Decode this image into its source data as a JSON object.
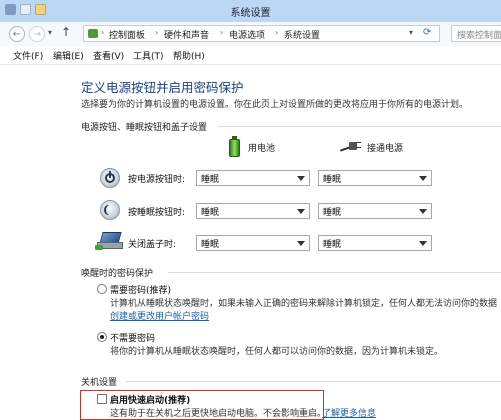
{
  "window": {
    "title": "系统设置"
  },
  "nav": {
    "back": "←",
    "forward": "→",
    "up": "↑",
    "dropdown": "▾"
  },
  "address": {
    "segments": [
      "控制面板",
      "硬件和声音",
      "电源选项",
      "系统设置"
    ],
    "separator": "›"
  },
  "search": {
    "placeholder": "搜索控制面"
  },
  "menu": [
    "文件(F)",
    "编辑(E)",
    "查看(V)",
    "工具(T)",
    "帮助(H)"
  ],
  "page": {
    "title": "定义电源按钮并启用密码保护",
    "description": "选择要为你的计算机设置的电源设置。你在此页上对设置所做的更改将应用于你所有的电源计划。"
  },
  "power_section": {
    "header": "电源按钮、睡眠按钮和盖子设置",
    "col_battery": "用电池",
    "col_plugged": "接通电源",
    "rows": [
      {
        "label": "按电源按钮时:",
        "battery": "睡眠",
        "plugged": "睡眠"
      },
      {
        "label": "按睡眠按钮时:",
        "battery": "睡眠",
        "plugged": "睡眠"
      },
      {
        "label": "关闭盖子时:",
        "battery": "睡眠",
        "plugged": "睡眠"
      }
    ]
  },
  "password_section": {
    "header": "唤醒时的密码保护",
    "options": [
      {
        "label": "需要密码(推荐)",
        "checked": false,
        "desc": "计算机从睡眠状态唤醒时，如果未输入正确的密码来解除计算机锁定，任何人都无法访问你的数据",
        "link": "创建或更改用户帐户密码"
      },
      {
        "label": "不需要密码",
        "checked": true,
        "desc": "将你的计算机从睡眠状态唤醒时，任何人都可以访问你的数据，因为计算机未锁定。"
      }
    ]
  },
  "shutdown_section": {
    "header": "关机设置",
    "fast_startup": {
      "label": "启用快速启动(推荐)",
      "checked": false,
      "desc": "这有助于在关机之后更快地启动电脑。不会影响重启。",
      "link": "了解更多信息"
    }
  },
  "colors": {
    "title_blue": "#1a3e8c",
    "link_blue": "#1a5fb4",
    "highlight_red": "#c0392b"
  }
}
